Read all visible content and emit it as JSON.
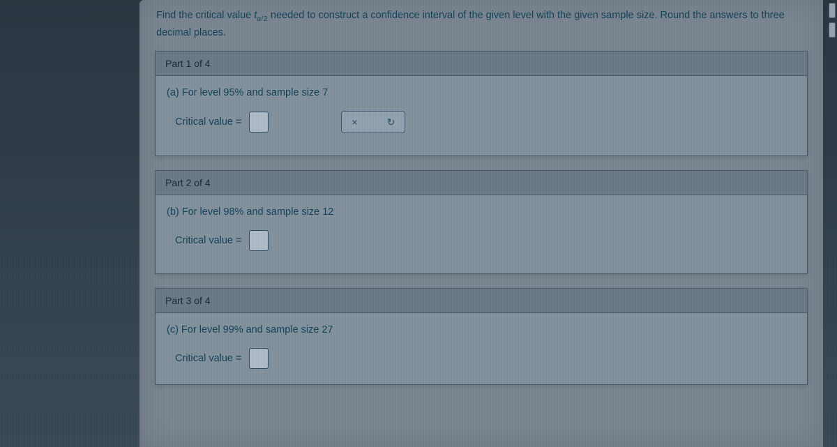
{
  "instruction": {
    "prefix": "Find the critical value ",
    "t_symbol": "t",
    "t_sub": "α/2",
    "suffix": " needed to construct a confidence interval of the given level with the given sample size. Round the answers to three decimal places."
  },
  "parts": [
    {
      "header": "Part 1 of 4",
      "question": "(a) For level 95% and sample size 7",
      "answer_label": "Critical value =",
      "show_controls": true,
      "ctrl_x_icon": "×",
      "ctrl_reset_icon": "↻"
    },
    {
      "header": "Part 2 of 4",
      "question": "(b) For level 98% and sample size 12",
      "answer_label": "Critical value =",
      "show_controls": false
    },
    {
      "header": "Part 3 of 4",
      "question": "(c) For level 99% and sample size 27",
      "answer_label": "Critical value =",
      "show_controls": false
    }
  ]
}
